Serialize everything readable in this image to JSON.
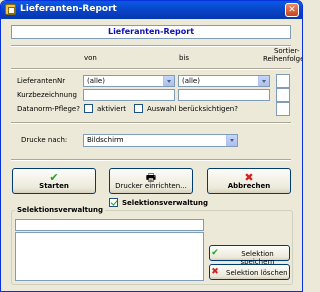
{
  "window": {
    "title": "Lieferanten-Report"
  },
  "header": {
    "title": "Lieferanten-Report"
  },
  "columns": {
    "from": "von",
    "to": "bis",
    "sort_line1": "Sortier-",
    "sort_line2": "Reihenfolge"
  },
  "fields": {
    "supplier_no": {
      "label": "LieferantenNr",
      "from_value": "(alle)",
      "to_value": "(alle)"
    },
    "short_name": {
      "label": "Kurzbezeichnung",
      "from_value": "",
      "to_value": ""
    },
    "datanorm": {
      "label": "Datanorm-Pflege?",
      "activated_label": "aktiviert",
      "consider_label": "Auswahl berücksichtigen?"
    }
  },
  "print": {
    "label": "Drucke nach:",
    "value": "Bildschirm"
  },
  "buttons": {
    "start": "Starten",
    "printer_setup": "Drucker einrichten...",
    "cancel": "Abbrechen",
    "save_selection": "Selektion speichern",
    "delete_selection": "Selektion löschen"
  },
  "selection": {
    "checkbox_label": "Selektionsverwaltung",
    "checked": true,
    "group_title": "Selektionsverwaltung",
    "name_value": ""
  },
  "icons": {
    "start": "green-check-icon",
    "printer": "printer-icon",
    "cancel": "red-x-icon",
    "save": "green-check-icon",
    "delete": "red-x-icon"
  },
  "colors": {
    "title_bar": "#0842c4",
    "header_text": "#1010b0",
    "check_green": "#21a121",
    "x_red": "#d42020"
  }
}
